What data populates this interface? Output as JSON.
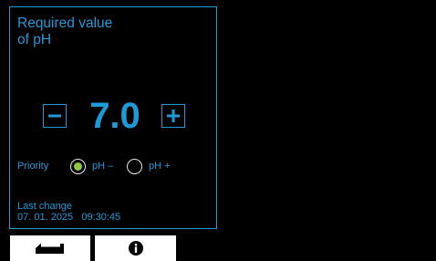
{
  "panel": {
    "title_line1": "Required value",
    "title_line2": "of pH"
  },
  "setpoint": {
    "value": "7.0",
    "decrease_icon": "minus-icon",
    "increase_icon": "plus-icon"
  },
  "priority": {
    "label": "Priority",
    "options": [
      {
        "label": "pH –",
        "selected": true
      },
      {
        "label": "pH +",
        "selected": false
      }
    ]
  },
  "last_change": {
    "label": "Last change",
    "date": "07. 01. 2025",
    "time": "09:30:45"
  },
  "softkeys": {
    "back_icon": "return-arrow-icon",
    "info_icon": "info-icon"
  },
  "colors": {
    "accent": "#1d9bd9",
    "background": "#000000",
    "selected_radio": "#8ec63f"
  }
}
